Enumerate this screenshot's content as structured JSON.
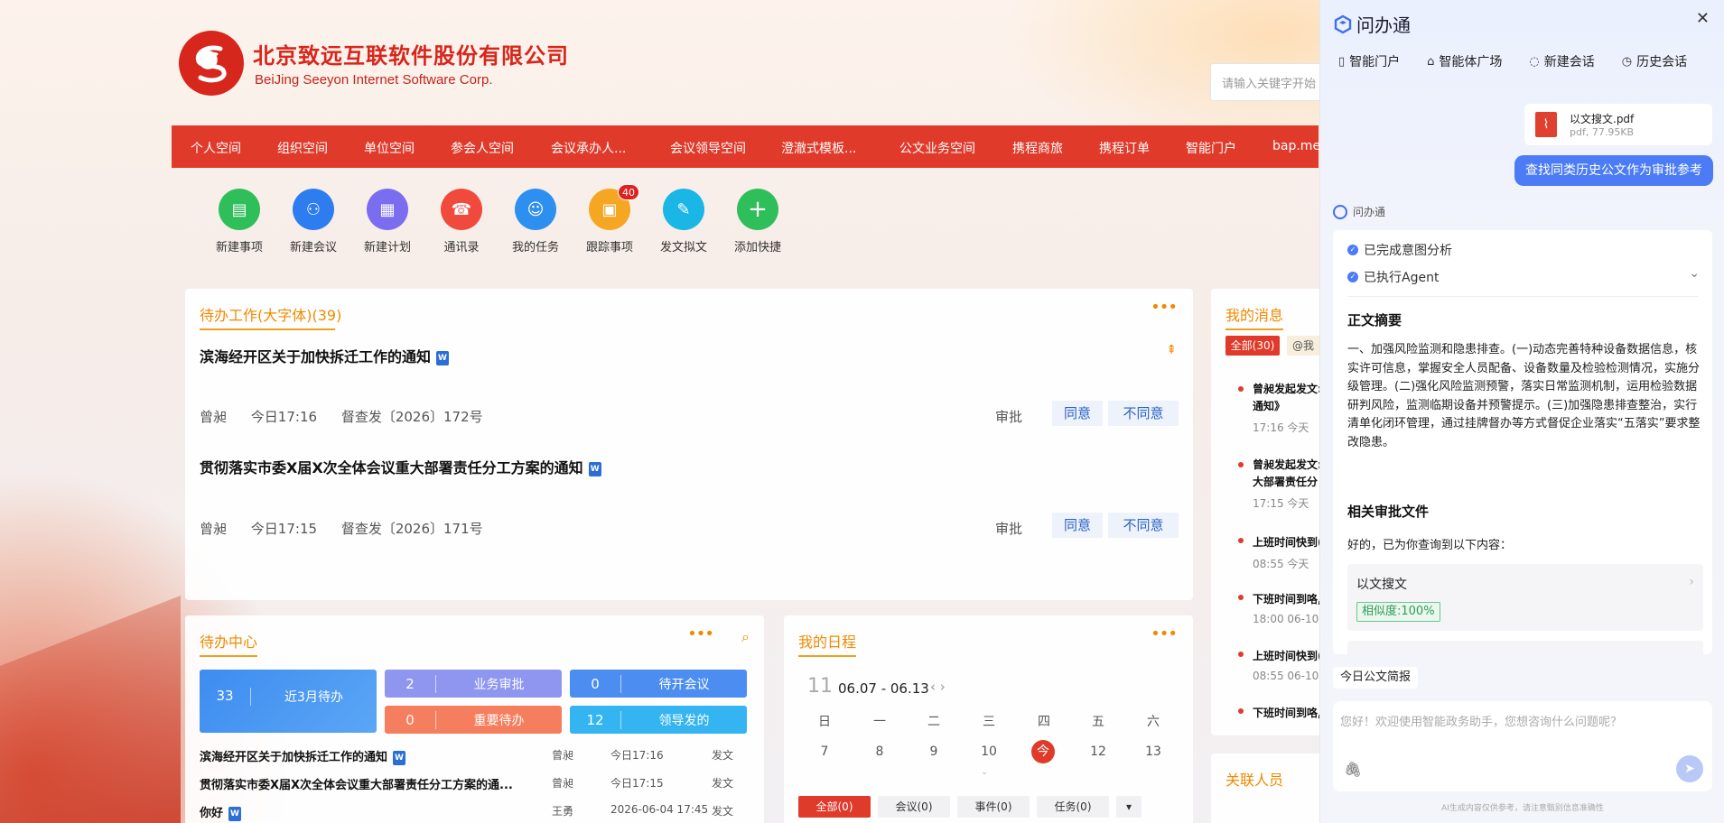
{
  "header": {
    "company_cn": "北京致远互联软件股份有限公司",
    "company_en": "BeiJing Seeyon Internet Software Corp.",
    "search_placeholder": "请输入关键字开始"
  },
  "nav": [
    "个人空间",
    "组织空间",
    "单位空间",
    "参会人空间",
    "会议承办人...",
    "会议领导空间",
    "澄澈式模板...",
    "公文业务空间",
    "携程商旅",
    "携程订单",
    "智能门户",
    "bap.men"
  ],
  "shortcuts": [
    {
      "label": "新建事项",
      "color": "#2fbf5a",
      "icon": "document-icon"
    },
    {
      "label": "新建会议",
      "color": "#2d7df0",
      "icon": "meeting-icon"
    },
    {
      "label": "新建计划",
      "color": "#7a6df0",
      "icon": "plan-icon"
    },
    {
      "label": "通讯录",
      "color": "#ef4a3c",
      "icon": "contacts-icon"
    },
    {
      "label": "我的任务",
      "color": "#2d8ff0",
      "icon": "task-icon"
    },
    {
      "label": "跟踪事项",
      "color": "#f5a623",
      "icon": "track-icon",
      "badge": "40"
    },
    {
      "label": "发文拟文",
      "color": "#19b6e6",
      "icon": "draft-icon"
    },
    {
      "label": "添加快捷",
      "color": "#2fbf5a",
      "icon": "plus-icon"
    }
  ],
  "todo": {
    "title": "待办工作(大字体)(39)",
    "items": [
      {
        "title": "滨海经开区关于加快拆迁工作的通知",
        "sender": "曾昶",
        "time": "今日17:16",
        "doc_no": "督查发〔2026〕172号",
        "action": "审批",
        "agree": "同意",
        "disagree": "不同意"
      },
      {
        "title": "贯彻落实市委X届X次全体会议重大部署责任分工方案的通知",
        "sender": "曾昶",
        "time": "今日17:15",
        "doc_no": "督查发〔2026〕171号",
        "action": "审批",
        "agree": "同意",
        "disagree": "不同意"
      }
    ]
  },
  "todo_center": {
    "title": "待办中心",
    "tiles": [
      {
        "num": "33",
        "label": "近3月待办"
      },
      {
        "num": "2",
        "label": "业务审批"
      },
      {
        "num": "0",
        "label": "待开会议"
      },
      {
        "num": "0",
        "label": "重要待办"
      },
      {
        "num": "12",
        "label": "领导发的"
      }
    ],
    "rows": [
      {
        "title": "滨海经开区关于加快拆迁工作的通知",
        "sender": "曾昶",
        "time": "今日17:16",
        "type": "发文"
      },
      {
        "title": "贯彻落实市委X届X次全体会议重大部署责任分工方案的通...",
        "sender": "曾昶",
        "time": "今日17:15",
        "type": "发文"
      },
      {
        "title": "你好",
        "sender": "王勇",
        "time": "2026-06-04 17:45",
        "type": "发文"
      }
    ]
  },
  "schedule": {
    "title": "我的日程",
    "month": "11",
    "range": "06.07 - 06.13",
    "weekdays": [
      "日",
      "一",
      "二",
      "三",
      "四",
      "五",
      "六"
    ],
    "days": [
      "7",
      "8",
      "9",
      "10",
      "今",
      "12",
      "13"
    ],
    "filters": [
      "全部(0)",
      "会议(0)",
      "事件(0)",
      "任务(0)"
    ]
  },
  "messages": {
    "title": "我的消息",
    "tab_all": "全部(30)",
    "tab_at": "@我",
    "items": [
      {
        "line1": "曾昶发起发文:",
        "line2": "通知》",
        "time": "17:16 今天"
      },
      {
        "line1": "曾昶发起发文:",
        "line2": "大部署责任分",
        "time": "17:15 今天"
      },
      {
        "line1": "上班时间快到(",
        "line2": "",
        "time": "08:55 今天"
      },
      {
        "line1": "下班时间到咯,",
        "line2": "",
        "time": "18:00 06-10"
      },
      {
        "line1": "上班时间快到(",
        "line2": "",
        "time": "08:55 06-10"
      },
      {
        "line1": "下班时间到咯,",
        "line2": "",
        "time": ""
      }
    ],
    "related": "关联人员"
  },
  "panel": {
    "app_name": "问办通",
    "tabs": [
      "智能门户",
      "智能体广场",
      "新建会话",
      "历史会话"
    ],
    "file": {
      "name": "以文搜文.pdf",
      "meta": "pdf, 77.95KB"
    },
    "user_message": "查找同类历史公文作为审批参考",
    "bot_name": "问办通",
    "steps": [
      "已完成意图分析",
      "已执行Agent"
    ],
    "summary_title": "正文摘要",
    "summary": "一、加强风险监测和隐患排查。(一)动态完善特种设备数据信息，核实许可信息，掌握安全人员配备、设备数量及检验检测情况，实施分级管理。(二)强化风险监测预警，落实日常监测机制，运用检验数据研判风险，监测临期设备并预警提示。(三)加强隐患排查整治，实行清单化闭环管理，通过挂牌督办等方式督促企业落实“五落实”要求整改隐患。",
    "related_title": "相关审批文件",
    "related_intro": "好的，已为你查询到以下内容：",
    "ref_title": "以文搜文",
    "similarity": "相似度:100%",
    "chip": "今日公文简报",
    "input_placeholder": "您好！欢迎使用智能政务助手，您想咨询什么问题呢？",
    "disclaimer": "AI生成内容仅供参考，请注意甄别信息准确性"
  }
}
